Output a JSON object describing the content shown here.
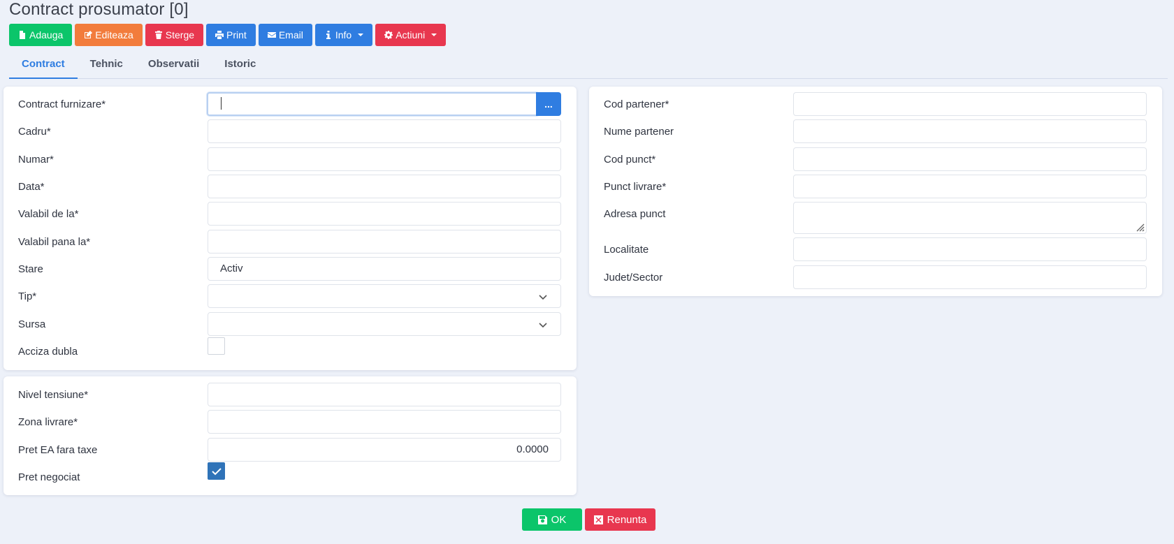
{
  "page_title": "Contract prosumator [0]",
  "toolbar": {
    "add": "Adauga",
    "edit": "Editeaza",
    "delete": "Sterge",
    "print": "Print",
    "email": "Email",
    "info": "Info",
    "actions": "Actiuni"
  },
  "tabs": [
    "Contract",
    "Tehnic",
    "Observatii",
    "Istoric"
  ],
  "contract_section": {
    "contract_furnizare": {
      "label": "Contract furnizare*",
      "value": ""
    },
    "browse_label": "...",
    "cadru": {
      "label": "Cadru*",
      "value": ""
    },
    "numar": {
      "label": "Numar*",
      "value": ""
    },
    "data": {
      "label": "Data*",
      "value": ""
    },
    "valabil_de_la": {
      "label": "Valabil de la*",
      "value": ""
    },
    "valabil_pana_la": {
      "label": "Valabil pana la*",
      "value": ""
    },
    "stare": {
      "label": "Stare",
      "value": "Activ"
    },
    "tip": {
      "label": "Tip*",
      "value": ""
    },
    "sursa": {
      "label": "Sursa",
      "value": ""
    },
    "acciza_dubla": {
      "label": "Acciza dubla",
      "checked": false
    }
  },
  "tension_section": {
    "nivel_tensiune": {
      "label": "Nivel tensiune*",
      "value": ""
    },
    "zona_livrare": {
      "label": "Zona livrare*",
      "value": ""
    },
    "pret_ea": {
      "label": "Pret EA fara taxe",
      "value": "0.0000"
    },
    "pret_negociat": {
      "label": "Pret negociat",
      "checked": true
    }
  },
  "partner_section": {
    "cod_partener": {
      "label": "Cod partener*",
      "value": ""
    },
    "nume_partener": {
      "label": "Nume partener",
      "value": ""
    },
    "cod_punct": {
      "label": "Cod punct*",
      "value": ""
    },
    "punct_livrare": {
      "label": "Punct livrare*",
      "value": ""
    },
    "adresa_punct": {
      "label": "Adresa punct",
      "value": ""
    },
    "localitate": {
      "label": "Localitate",
      "value": ""
    },
    "judet_sector": {
      "label": "Judet/Sector",
      "value": ""
    }
  },
  "footer": {
    "ok": "OK",
    "cancel": "Renunta"
  },
  "colors": {
    "green": "#0bc56a",
    "orange": "#f27c3c",
    "red": "#e8374f",
    "blue": "#2f7de1",
    "checkbox": "#2f73b8",
    "background": "#edf1f9"
  }
}
